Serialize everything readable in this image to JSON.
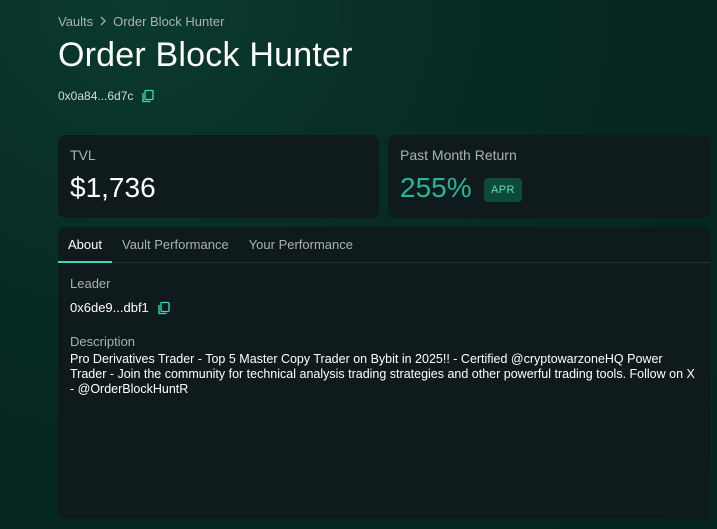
{
  "breadcrumb": {
    "root": "Vaults",
    "current": "Order Block Hunter"
  },
  "header": {
    "title": "Order Block Hunter",
    "address": "0x0a84...6d7c"
  },
  "stats": {
    "tvl_label": "TVL",
    "tvl_value": "$1,736",
    "return_label": "Past Month Return",
    "return_value": "255%",
    "return_badge": "APR"
  },
  "tabs": [
    {
      "label": "About",
      "active": true
    },
    {
      "label": "Vault Performance",
      "active": false
    },
    {
      "label": "Your Performance",
      "active": false
    }
  ],
  "about": {
    "leader_label": "Leader",
    "leader_address": "0x6de9...dbf1",
    "description_label": "Description",
    "description_text": "Pro Derivatives Trader - Top 5 Master Copy Trader on Bybit in 2025!! - Certified @cryptowarzoneHQ Power Trader - Join the community for technical analysis trading strategies and other powerful trading tools. Follow on X - @OrderBlockHuntR"
  },
  "colors": {
    "background": "#06241d",
    "card": "#0f1a1c",
    "accent": "#3ddcb0",
    "return_green": "#23b88f",
    "badge_bg": "#0e4a3b"
  },
  "icons": {
    "copy": "copy-icon",
    "breadcrumb_separator": "chevron-right-icon"
  }
}
